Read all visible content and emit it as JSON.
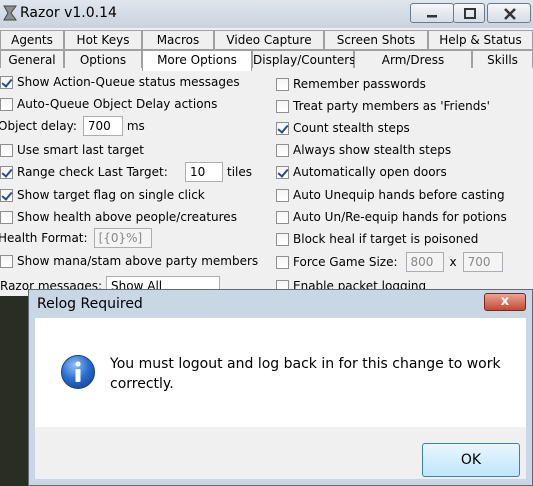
{
  "window": {
    "title": "Razor v1.0.14",
    "minimize_icon": "minimize-icon",
    "restore_icon": "restore-icon",
    "close_icon": "close-icon"
  },
  "tabs_row1": [
    "Agents",
    "Hot Keys",
    "Macros",
    "Video Capture",
    "Screen Shots",
    "Help & Status"
  ],
  "tabs_row2": [
    "General",
    "Options",
    "More Options",
    "Display/Counters",
    "Arm/Dress",
    "Skills"
  ],
  "active_tab": "More Options",
  "left": {
    "show_queue_status": {
      "label": "Show Action-Queue status messages",
      "checked": true
    },
    "auto_queue_delay": {
      "label": "Auto-Queue Object Delay actions",
      "checked": false
    },
    "object_delay": {
      "label": "Object delay:",
      "value": "700",
      "unit": "ms"
    },
    "smart_last_target": {
      "label": "Use smart last target",
      "checked": false
    },
    "range_check": {
      "label": "Range check Last Target:",
      "checked": true,
      "value": "10",
      "unit": "tiles"
    },
    "target_flag": {
      "label": "Show target flag on single click",
      "checked": true
    },
    "show_health": {
      "label": "Show health above people/creatures",
      "checked": false
    },
    "health_format": {
      "label": "Health Format:",
      "value": "[{0}%]"
    },
    "mana_stam": {
      "label": "Show mana/stam above party members",
      "checked": false
    },
    "razor_messages": {
      "label": "Razor messages:",
      "value": "Show All"
    }
  },
  "right": {
    "remember_passwords": {
      "label": "Remember passwords",
      "checked": false
    },
    "party_friends": {
      "label": "Treat party members as 'Friends'",
      "checked": false
    },
    "count_stealth": {
      "label": "Count stealth steps",
      "checked": true
    },
    "always_stealth": {
      "label": "Always show stealth steps",
      "checked": false
    },
    "open_doors": {
      "label": "Automatically open doors",
      "checked": true
    },
    "auto_unequip": {
      "label": "Auto Unequip hands before casting",
      "checked": false
    },
    "auto_reequip": {
      "label": "Auto Un/Re-equip hands for potions",
      "checked": false
    },
    "block_heal": {
      "label": "Block heal if target is poisoned",
      "checked": false
    },
    "force_size": {
      "label": "Force Game Size:",
      "checked": false,
      "width": "800",
      "sep": "x",
      "height": "700"
    },
    "packet_logging": {
      "label": "Enable packet logging",
      "checked": false
    }
  },
  "dialog": {
    "title": "Relog Required",
    "message": "You must logout and log back in for this change to work correctly.",
    "ok_label": "OK",
    "icon": "info-icon",
    "close_symbol": "x"
  }
}
